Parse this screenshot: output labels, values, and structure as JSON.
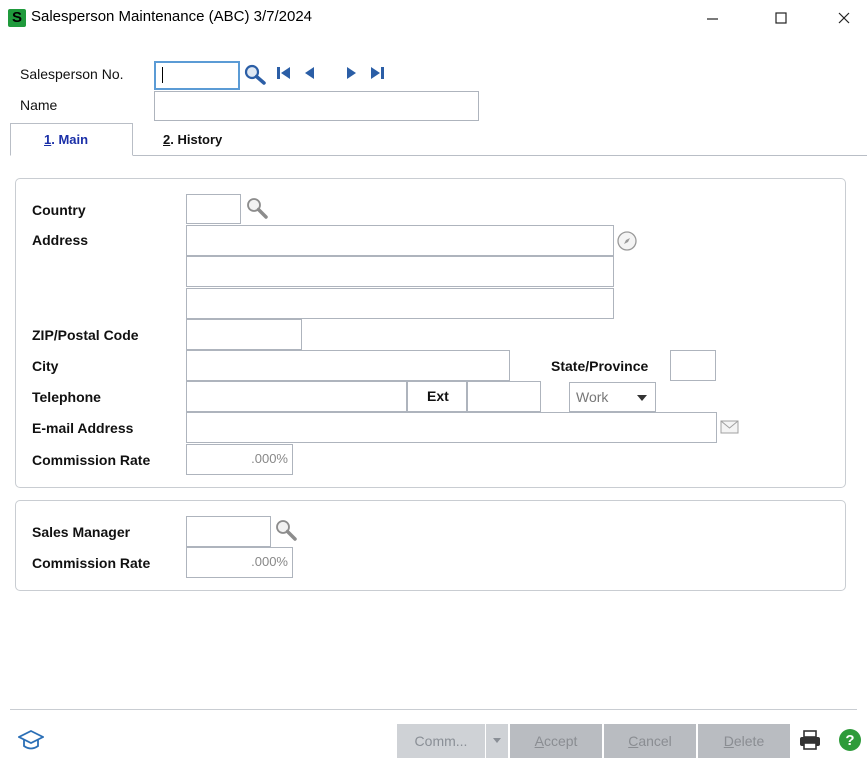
{
  "window": {
    "title": "Salesperson Maintenance (ABC) 3/7/2024",
    "app_icon_letter": "S",
    "minimize_label": "—",
    "close_label": "✕"
  },
  "header": {
    "salesperson_no_label": "Salesperson No.",
    "salesperson_no_value": "",
    "name_label": "Name",
    "name_value": ""
  },
  "tabs": [
    {
      "key": "1",
      "label": ". Main",
      "selected": true
    },
    {
      "key": "2",
      "label": ". History",
      "selected": false
    }
  ],
  "main_panel": {
    "country_label": "Country",
    "country_value": "",
    "address_label": "Address",
    "address_lines": [
      "",
      "",
      ""
    ],
    "zip_label": "ZIP/Postal Code",
    "zip_value": "",
    "city_label": "City",
    "city_value": "",
    "state_label": "State/Province",
    "state_value": "",
    "telephone_label": "Telephone",
    "telephone_value": "",
    "ext_label": "Ext",
    "ext_value": "",
    "phone_type_selected": "Work",
    "email_label": "E-mail Address",
    "email_value": "",
    "commission_label": "Commission Rate",
    "commission_value": ".000%"
  },
  "manager_panel": {
    "sales_manager_label": "Sales Manager",
    "sales_manager_value": "",
    "commission_label": "Commission Rate",
    "commission_value": ".000%"
  },
  "footer": {
    "comm_label": "Comm...",
    "accept_first": "A",
    "accept_rest": "ccept",
    "cancel_first": "C",
    "cancel_rest": "ancel",
    "delete_first": "D",
    "delete_rest": "elete"
  },
  "colors": {
    "accent_blue": "#1a2fa8",
    "app_green": "#1f9a3c",
    "button_disabled": "#cfd2d6",
    "help_green": "#2e9b3a"
  },
  "icons": [
    "app-icon",
    "minimize-icon",
    "maximize-icon",
    "close-icon",
    "search-icon",
    "first-record-icon",
    "previous-record-icon",
    "next-record-icon",
    "last-record-icon",
    "compass-icon",
    "email-icon",
    "education-cap-icon",
    "print-icon",
    "help-icon",
    "dropdown-arrow-icon"
  ]
}
